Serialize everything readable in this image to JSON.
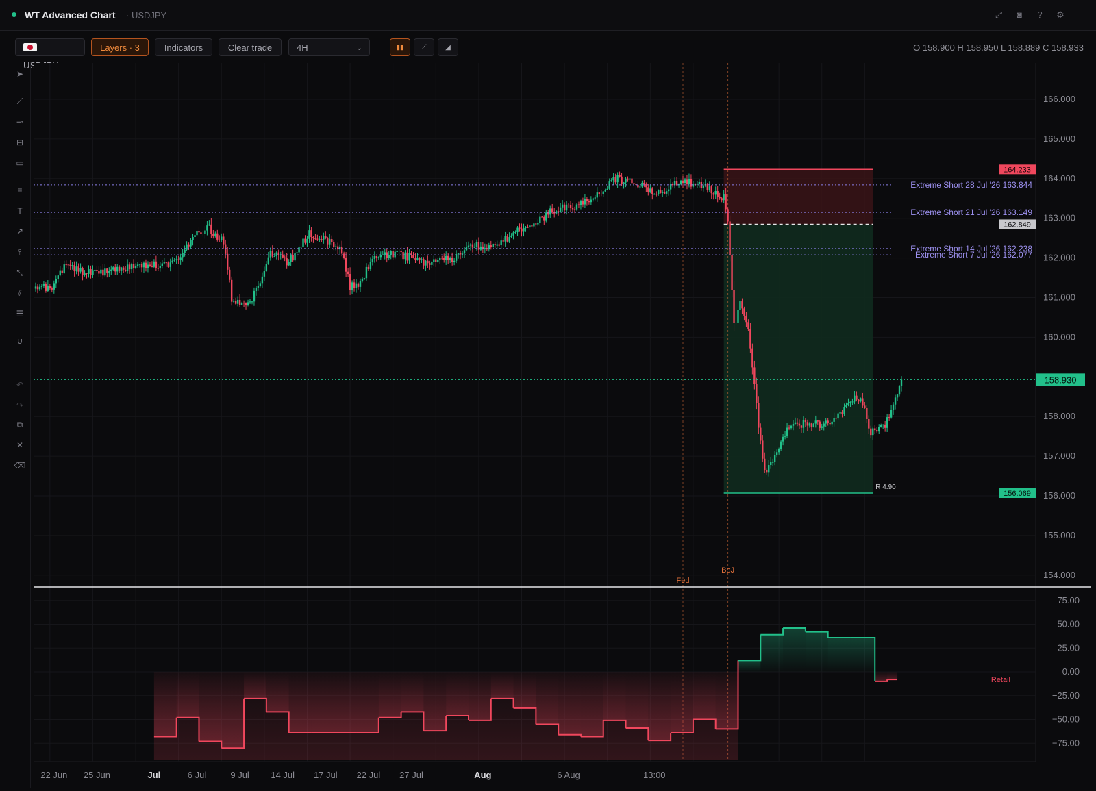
{
  "window": {
    "title": "WT Advanced Chart",
    "subtitle": "· USDJPY",
    "icons": [
      "expand-icon",
      "camera-icon",
      "help-icon",
      "settings-icon"
    ]
  },
  "toolbar": {
    "symbol_label": "USDJPY",
    "layers_label": "Layers · 3",
    "indicators_label": "Indicators",
    "clear_trade_label": "Clear trade",
    "timeframe_value": "4H",
    "chart_type_icons": [
      "candles-icon",
      "line-icon",
      "area-icon"
    ],
    "accent_color": "#f08a3c"
  },
  "ohlc": {
    "text": "O 158.900 H 158.950 L 158.889 C 158.933",
    "open": 158.9,
    "high": 158.95,
    "low": 158.889,
    "close": 158.933
  },
  "left_tools": [
    "cursor-icon",
    "trendline-icon",
    "horizontal-ray-icon",
    "horizontal-band-icon",
    "rectangle-icon",
    "fib-icon",
    "text-icon",
    "arrow-icon",
    "vertical-line-icon",
    "measure-icon",
    "parallel-channel-icon",
    "long-position-icon",
    "magnet-icon",
    "undo-icon",
    "redo-icon",
    "external-link-icon",
    "close-icon",
    "trash-icon"
  ],
  "chart_data": [
    {
      "type": "candlestick",
      "symbol": "USDJPY",
      "timeframe": "4H",
      "y_axis_ticks": [
        "166.000",
        "165.000",
        "164.000",
        "163.000",
        "162.000",
        "161.000",
        "160.000",
        "158.000",
        "157.000",
        "156.000",
        "155.000",
        "154.000"
      ],
      "ylim": [
        153.65,
        166.8
      ],
      "x_axis_ticks": [
        {
          "label": "22 Jun",
          "bold": false
        },
        {
          "label": "25 Jun",
          "bold": false
        },
        {
          "label": "Jul",
          "bold": true
        },
        {
          "label": "6 Jul",
          "bold": false
        },
        {
          "label": "9 Jul",
          "bold": false
        },
        {
          "label": "14 Jul",
          "bold": false
        },
        {
          "label": "17 Jul",
          "bold": false
        },
        {
          "label": "22 Jul",
          "bold": false
        },
        {
          "label": "27 Jul",
          "bold": false
        },
        {
          "label": "Aug",
          "bold": true
        },
        {
          "label": "6 Aug",
          "bold": false
        },
        {
          "label": "13:00",
          "bold": false
        }
      ],
      "anchors_close": [
        [
          0,
          161.3
        ],
        [
          8,
          161.2
        ],
        [
          15,
          161.8
        ],
        [
          25,
          161.6
        ],
        [
          40,
          161.7
        ],
        [
          55,
          161.8
        ],
        [
          70,
          161.9
        ],
        [
          80,
          162.6
        ],
        [
          85,
          162.8
        ],
        [
          93,
          162.4
        ],
        [
          97,
          161.0
        ],
        [
          105,
          160.8
        ],
        [
          110,
          161.3
        ],
        [
          116,
          162.1
        ],
        [
          125,
          161.9
        ],
        [
          135,
          162.6
        ],
        [
          150,
          162.3
        ],
        [
          155,
          161.3
        ],
        [
          160,
          161.4
        ],
        [
          168,
          162.1
        ],
        [
          180,
          162.1
        ],
        [
          190,
          161.9
        ],
        [
          205,
          162.0
        ],
        [
          215,
          162.3
        ],
        [
          225,
          162.3
        ],
        [
          235,
          162.6
        ],
        [
          245,
          162.9
        ],
        [
          255,
          163.2
        ],
        [
          265,
          163.3
        ],
        [
          275,
          163.6
        ],
        [
          285,
          164.0
        ],
        [
          295,
          163.9
        ],
        [
          305,
          163.6
        ],
        [
          315,
          163.9
        ],
        [
          325,
          163.9
        ],
        [
          333,
          163.7
        ],
        [
          338,
          163.5
        ],
        [
          340,
          162.9
        ],
        [
          343,
          160.3
        ],
        [
          346,
          160.8
        ],
        [
          350,
          160.2
        ],
        [
          355,
          157.8
        ],
        [
          358,
          156.6
        ],
        [
          362,
          156.9
        ],
        [
          368,
          157.6
        ],
        [
          375,
          157.8
        ],
        [
          390,
          157.8
        ],
        [
          400,
          158.4
        ],
        [
          405,
          158.5
        ],
        [
          410,
          157.6
        ],
        [
          413,
          157.6
        ],
        [
          417,
          157.8
        ],
        [
          422,
          158.5
        ],
        [
          425,
          158.93
        ]
      ],
      "current_price": {
        "value": 158.93,
        "label": "158.930",
        "color": "#22c08a"
      },
      "horizontal_levels": [
        {
          "label": "Extreme Short 28 Jul '26 163.844",
          "value": 163.844
        },
        {
          "label": "Extreme Short 21 Jul '26 163.149",
          "value": 163.149
        },
        {
          "label": "Extreme Short 14 Jul '26 162.238",
          "value": 162.238
        },
        {
          "label": "Extreme Short 7 Jul '26 162.077",
          "value": 162.077
        }
      ],
      "position_tool": {
        "side": "short",
        "stop": {
          "value": 164.233,
          "label": "164.233"
        },
        "entry": {
          "value": 162.849,
          "label": "162.849"
        },
        "target": {
          "value": 156.069,
          "label": "156.069"
        },
        "ratio_label": "R 4.90",
        "start_index": 338,
        "end_index": 411
      },
      "events": [
        {
          "label": "Fed",
          "index": 318
        },
        {
          "label": "BoJ",
          "index": 340
        }
      ],
      "colors": {
        "up": "#22c08a",
        "down": "#f0475d",
        "level": "#8b7fe8",
        "event": "#e0703a"
      }
    },
    {
      "type": "area",
      "name": "Retail",
      "y_axis_ticks": [
        "75.00",
        "50.00",
        "25.00",
        "0.00",
        "−25.00",
        "−50.00",
        "−75.00"
      ],
      "ylim": [
        -100,
        80
      ],
      "steps": [
        [
          59,
          -68
        ],
        [
          70,
          -48
        ],
        [
          81,
          -73
        ],
        [
          92,
          -80
        ],
        [
          103,
          -28
        ],
        [
          114,
          -42
        ],
        [
          125,
          -64
        ],
        [
          136,
          -64
        ],
        [
          147,
          -64
        ],
        [
          158,
          -64
        ],
        [
          169,
          -48
        ],
        [
          180,
          -42
        ],
        [
          191,
          -62
        ],
        [
          202,
          -46
        ],
        [
          213,
          -51
        ],
        [
          224,
          -28
        ],
        [
          235,
          -38
        ],
        [
          246,
          -55
        ],
        [
          257,
          -66
        ],
        [
          268,
          -68
        ],
        [
          279,
          -51
        ],
        [
          290,
          -59
        ],
        [
          301,
          -72
        ],
        [
          312,
          -64
        ],
        [
          323,
          -50
        ],
        [
          334,
          -60
        ],
        [
          345,
          12
        ],
        [
          356,
          39
        ],
        [
          367,
          46
        ],
        [
          378,
          42
        ],
        [
          389,
          36
        ],
        [
          400,
          36
        ],
        [
          411,
          36
        ],
        [
          412,
          -10
        ],
        [
          418,
          -8
        ],
        [
          423,
          -8
        ]
      ],
      "colors": {
        "up": "#22c08a",
        "down": "#f0475d"
      }
    }
  ]
}
